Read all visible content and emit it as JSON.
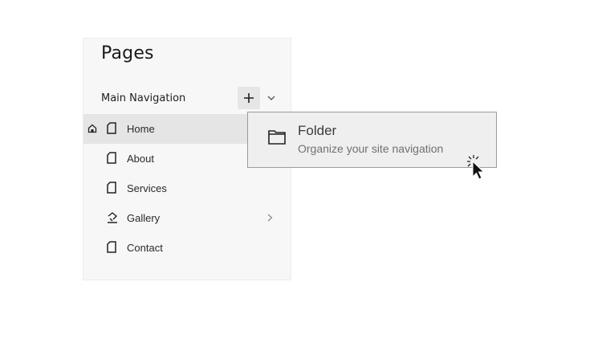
{
  "panel": {
    "title": "Pages",
    "section_label": "Main Navigation",
    "items": [
      {
        "label": "Home",
        "icon": "page-icon",
        "active": true,
        "is_home": true
      },
      {
        "label": "About",
        "icon": "page-icon"
      },
      {
        "label": "Services",
        "icon": "page-icon"
      },
      {
        "label": "Gallery",
        "icon": "gallery-icon",
        "has_children": true
      },
      {
        "label": "Contact",
        "icon": "page-icon"
      }
    ]
  },
  "dropdown": {
    "option_title": "Folder",
    "option_description": "Organize your site navigation",
    "icon": "folder-icon"
  },
  "colors": {
    "panel_bg": "#f7f7f7",
    "active_item_bg": "#e5e5e5",
    "dropdown_bg": "#efefef",
    "dropdown_border": "#9b9b9b"
  }
}
